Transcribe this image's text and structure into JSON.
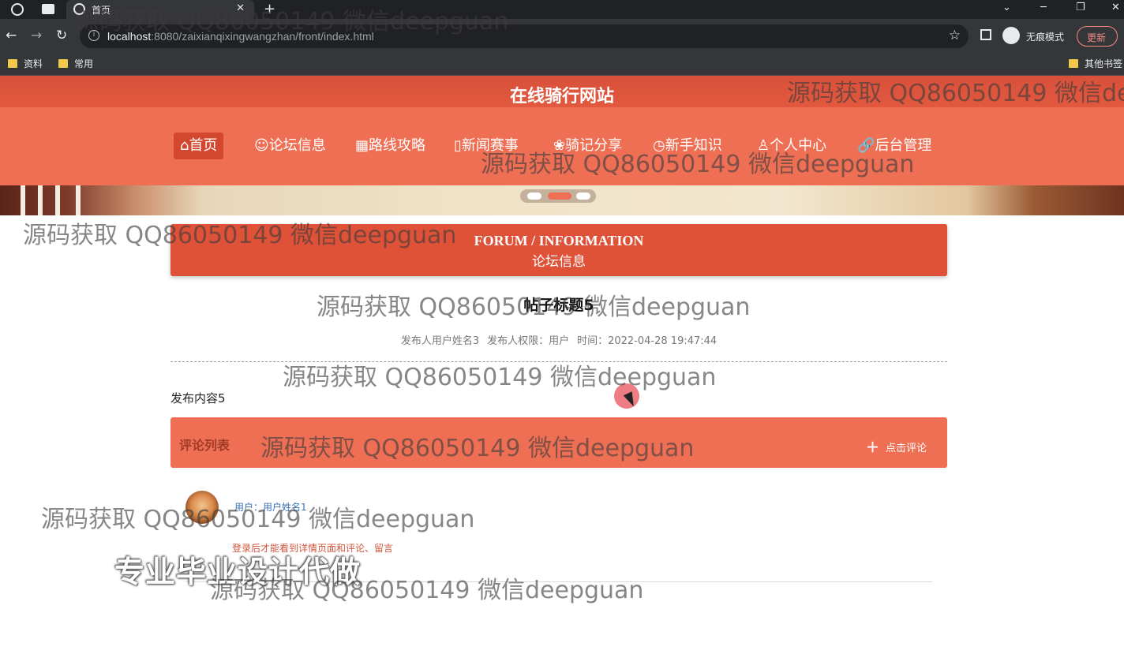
{
  "browser": {
    "tab_title": "首页",
    "tab_close": "✕",
    "new_tab": "+",
    "url_host": "localhost",
    "url_rest": ":8080/zaixianqixingwangzhan/front/index.html",
    "incognito_label": "无痕模式",
    "update_label": "更新",
    "bookmarks": [
      "资料",
      "常用"
    ],
    "other_bookmarks": "其他书签",
    "icons": [
      "back-arrow-icon",
      "forward-arrow-icon",
      "reload-icon",
      "info-icon",
      "star-icon",
      "sidepanel-icon",
      "incognito-icon",
      "menu-dots-icon"
    ]
  },
  "site": {
    "title": "在线骑行网站",
    "nav": [
      {
        "icon": "home-icon",
        "glyph": "⌂",
        "label": "首页"
      },
      {
        "icon": "forum-icon",
        "glyph": "☺",
        "label": "论坛信息"
      },
      {
        "icon": "route-icon",
        "glyph": "▦",
        "label": "路线攻略"
      },
      {
        "icon": "news-icon",
        "glyph": "▯",
        "label": "新闻赛事"
      },
      {
        "icon": "share-icon",
        "glyph": "❀",
        "label": "骑记分享"
      },
      {
        "icon": "knowledge-icon",
        "glyph": "◷",
        "label": "新手知识"
      },
      {
        "icon": "user-icon",
        "glyph": "♙",
        "label": "个人中心"
      },
      {
        "icon": "link-icon",
        "glyph": "🔗",
        "label": "后台管理"
      }
    ]
  },
  "forum": {
    "heading_en": "FORUM / INFORMATION",
    "heading_cn": "论坛信息",
    "post_title": "帖子标题5",
    "publisher": "发布人用户姓名3",
    "role": "发布人权限：用户",
    "time": "时间：2022-04-28 19:47:44",
    "content": "发布内容5"
  },
  "comments": {
    "title": "评论列表",
    "add_label": "点击评论",
    "add_icon": "＋",
    "user": "用户：用户姓名1",
    "note": "登录后才能看到详情页面和评论、留言"
  },
  "overlay": {
    "pro_label": "专业毕业设计代做",
    "watermark": "源码获取 QQ86050149 微信deepguan"
  },
  "colors": {
    "primary": "#ef6f55",
    "header_dark": "#df5238",
    "chrome_dark": "#202124",
    "chrome_toolbar": "#35363a"
  }
}
